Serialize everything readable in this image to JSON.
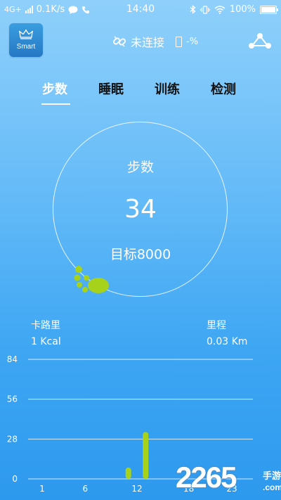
{
  "status_bar": {
    "network": "4G+",
    "speed": "0.1K/s",
    "time": "14:40",
    "battery": "100%"
  },
  "header": {
    "logo_text": "Smart",
    "connection_status": "未连接",
    "device_battery": "-%"
  },
  "tabs": [
    {
      "label": "步数",
      "active": true
    },
    {
      "label": "睡眠",
      "active": false
    },
    {
      "label": "训练",
      "active": false
    },
    {
      "label": "检测",
      "active": false
    }
  ],
  "ring": {
    "label": "步数",
    "value": "34",
    "goal": "目标8000"
  },
  "metrics": {
    "calories_label": "卡路里",
    "calories_value": "1 Kcal",
    "distance_label": "里程",
    "distance_value": "0.03 Km"
  },
  "chart_data": {
    "type": "bar",
    "y_ticks": [
      "84",
      "56",
      "28",
      "0"
    ],
    "x_ticks": [
      "1",
      "6",
      "12",
      "18",
      "23"
    ],
    "ylim": [
      0,
      84
    ],
    "bars": [
      {
        "hour": 11,
        "value": 8
      },
      {
        "hour": 13,
        "value": 33
      }
    ],
    "bar_color": "#a6d21c"
  },
  "watermark": {
    "number": "2265",
    "suffix": ".com",
    "site_name": "手游网"
  }
}
